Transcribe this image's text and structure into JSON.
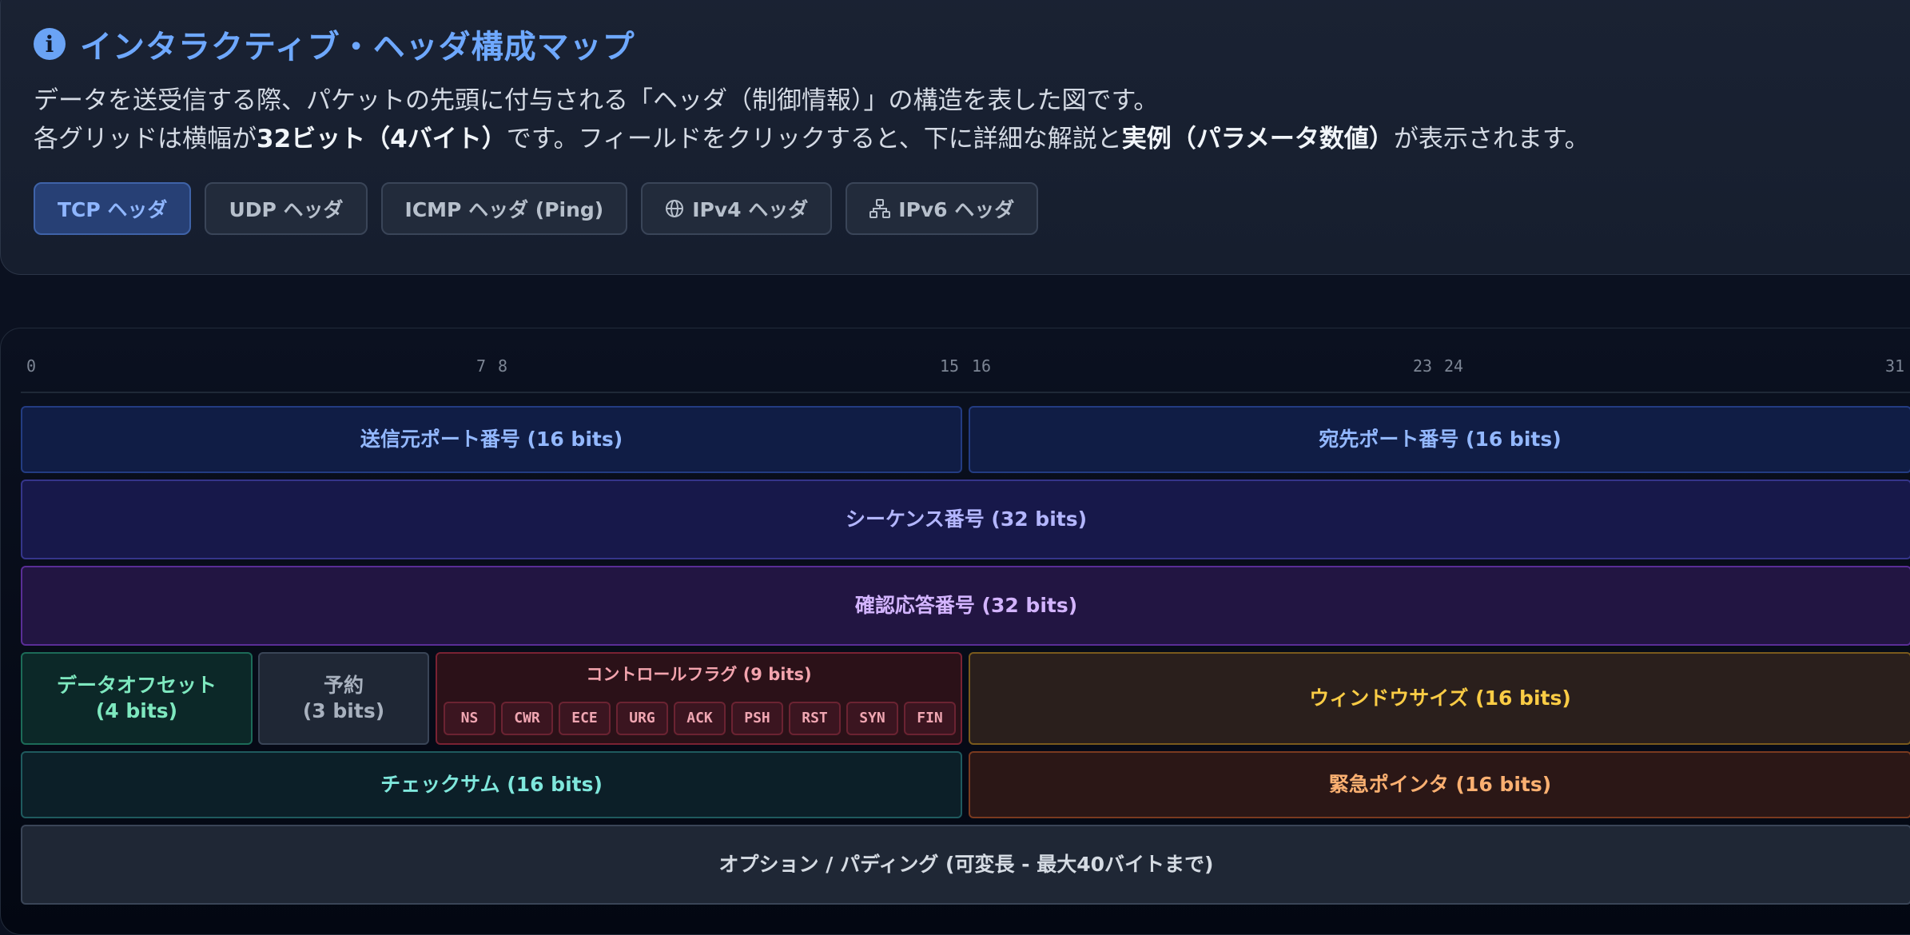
{
  "header": {
    "icon": "info-icon",
    "title": "インタラクティブ・ヘッダ構成マップ",
    "desc_line1": "データを送受信する際、パケットの先頭に付与される「ヘッダ（制御情報）」の構造を表した図です。",
    "desc_line2_a": "各グリッドは横幅が",
    "desc_line2_b": "32ビット（4バイト）",
    "desc_line2_c": "です。フィールドをクリックすると、下に詳細な解説と",
    "desc_line2_d": "実例（パラメータ数値）",
    "desc_line2_e": "が表示されます。"
  },
  "tabs": [
    {
      "label": "TCP ヘッダ",
      "active": true
    },
    {
      "label": "UDP ヘッダ"
    },
    {
      "label": "ICMP ヘッダ (Ping)"
    },
    {
      "label": "IPv4 ヘッダ",
      "icon": "globe-icon"
    },
    {
      "label": "IPv6 ヘッダ",
      "icon": "network-icon"
    }
  ],
  "ruler": [
    "0",
    "7",
    "8",
    "15",
    "16",
    "23",
    "24",
    "31"
  ],
  "fields": {
    "src_port": "送信元ポート番号 (16 bits)",
    "dst_port": "宛先ポート番号 (16 bits)",
    "seq": "シーケンス番号 (32 bits)",
    "ack": "確認応答番号 (32 bits)",
    "offset_1": "データオフセット",
    "offset_2": "(4 bits)",
    "reserved_1": "予約",
    "reserved_2": "(3 bits)",
    "flags_title": "コントロールフラグ (9 bits)",
    "flags": [
      "NS",
      "CWR",
      "ECE",
      "URG",
      "ACK",
      "PSH",
      "RST",
      "SYN",
      "FIN"
    ],
    "window": "ウィンドウサイズ (16 bits)",
    "checksum": "チェックサム (16 bits)",
    "urgent": "緊急ポインタ (16 bits)",
    "options": "オプション / パディング (可変長 - 最大40バイトまで)"
  }
}
